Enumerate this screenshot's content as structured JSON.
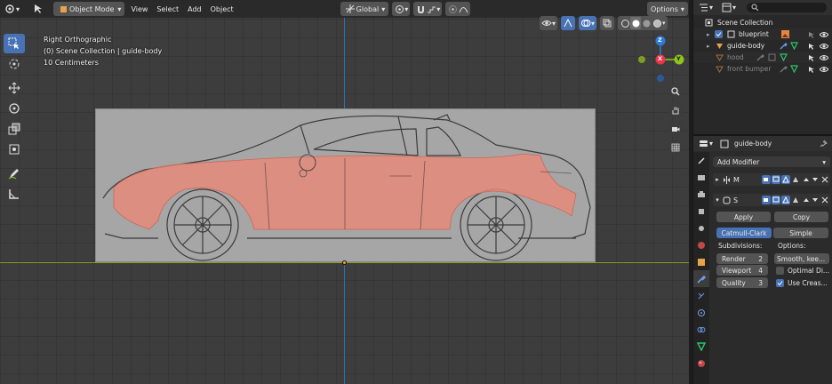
{
  "header": {
    "mode_label": "Object Mode",
    "menu": [
      "View",
      "Select",
      "Add",
      "Object"
    ],
    "transform_orientation": "Global",
    "options_label": "Options"
  },
  "viewport_info": {
    "view_name": "Right Orthographic",
    "collection_line": "(0) Scene Collection | guide-body",
    "scale_line": "10 Centimeters"
  },
  "gizmo": {
    "z": "Z",
    "x": "X",
    "y": "Y"
  },
  "outliner": {
    "root": "Scene Collection",
    "items": [
      {
        "label": "blueprint",
        "dim": false
      },
      {
        "label": "guide-body",
        "dim": false
      },
      {
        "label": "hood",
        "dim": true
      },
      {
        "label": "front bumper",
        "dim": true
      }
    ]
  },
  "properties": {
    "object_name": "guide-body",
    "add_modifier_label": "Add Modifier",
    "modifier1_short": "M",
    "modifier2_short": "S",
    "apply_label": "Apply",
    "copy_label": "Copy",
    "catmull_label": "Catmull-Clark",
    "simple_label": "Simple",
    "subdivisions_label": "Subdivisions:",
    "options_label": "Options:",
    "render_label": "Render",
    "render_value": "2",
    "viewport_label": "Viewport",
    "viewport_value": "4",
    "quality_label": "Quality",
    "quality_value": "3",
    "uv_smooth_label": "Smooth, kee...",
    "optimal_label": "Optimal Di...",
    "creases_label": "Use Creas..."
  },
  "colors": {
    "accent": "#4772b3",
    "axis_x": "#e8374a",
    "axis_y": "#8fc31f",
    "axis_z": "#2e7bd6",
    "body_paint": "#e58a7a"
  }
}
